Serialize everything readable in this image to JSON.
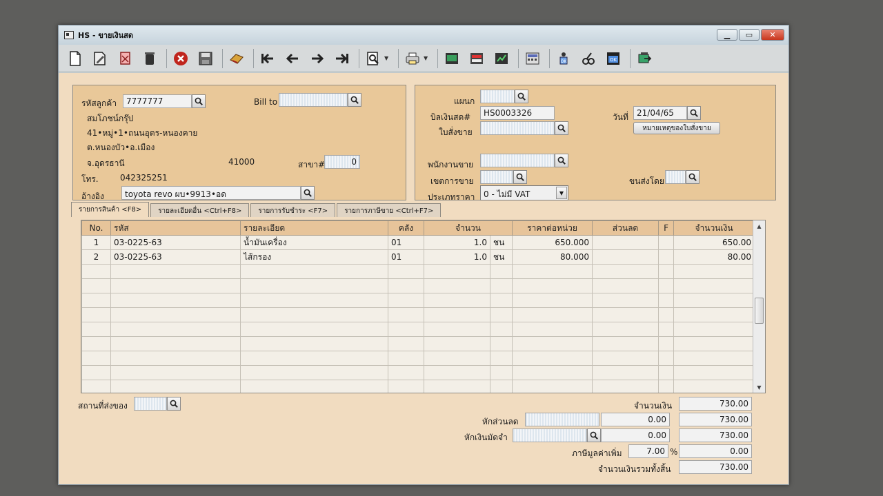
{
  "window": {
    "title": "HS - ขายเงินสด"
  },
  "toolbar": {
    "icons": [
      "new-document-icon",
      "edit-icon",
      "copy-icon",
      "delete-trash-icon",
      "cancel-icon",
      "save-icon",
      "tools-icon",
      "first-record-icon",
      "previous-record-icon",
      "next-record-icon",
      "last-record-icon",
      "search-icon",
      "print-icon",
      "report-icon",
      "excel-export-icon",
      "chart-icon",
      "calculator-icon",
      "approve-icon",
      "link-icon",
      "ok-icon",
      "exit-icon"
    ]
  },
  "customer": {
    "code_label": "รหัสลูกค้า",
    "code_value": "7777777",
    "bill_to_label": "Bill to",
    "name": "สมโภชน์กรุ๊ป",
    "address_line1": "41•หมู่•1•ถนนอุดร-หนองคาย",
    "address_line2": "ต.หนองบัว•อ.เมือง",
    "province": "จ.อุดรธานี",
    "postcode": "41000",
    "branch_label": "สาขา#",
    "branch_value": "0",
    "phone_label": "โทร.",
    "phone_value": "042325251",
    "reference_label": "อ้างอิง",
    "reference_value": "toyota revo ผบ•9913•อด"
  },
  "document": {
    "department_label": "แผนก",
    "bill_no_label": "บิลเงินสด#",
    "bill_no_value": "HS0003326",
    "date_label": "วันที่",
    "date_value": "21/04/65",
    "sales_order_label": "ใบสั่งขาย",
    "sales_order_note_button": "หมายเหตุของใบสั่งขาย",
    "salesperson_label": "พนักงานขาย",
    "sales_area_label": "เขตการขาย",
    "ship_by_label": "ขนส่งโดย",
    "price_type_label": "ประเภทราคา",
    "price_type_value": "0 - ไม่มี VAT"
  },
  "tabs": [
    {
      "label": "รายการสินค้า <F8>",
      "active": true
    },
    {
      "label": "รายละเอียดอื่น <Ctrl+F8>",
      "active": false
    },
    {
      "label": "รายการรับชำระ <F7>",
      "active": false
    },
    {
      "label": "รายการภาษีขาย <Ctrl+F7>",
      "active": false
    }
  ],
  "grid": {
    "headers": {
      "no": "No.",
      "code": "รหัส",
      "desc": "รายละเอียด",
      "wh": "คลัง",
      "qty": "จำนวน",
      "price": "ราคาต่อหน่วย",
      "disc": "ส่วนลด",
      "f": "F",
      "amount": "จำนวนเงิน"
    },
    "rows": [
      {
        "no": "1",
        "code": "03-0225-63",
        "desc": "น้ำมันเครื่อง",
        "wh": "01",
        "qty": "1.0",
        "unit": "ชน",
        "price": "650.000",
        "disc": "",
        "f": "",
        "amount": "650.00"
      },
      {
        "no": "2",
        "code": "03-0225-63",
        "desc": "ไส้กรอง",
        "wh": "01",
        "qty": "1.0",
        "unit": "ชน",
        "price": "80.000",
        "disc": "",
        "f": "",
        "amount": "80.00"
      }
    ]
  },
  "footer": {
    "ship_place_label": "สถานที่ส่งของ",
    "amount_label": "จำนวนเงิน",
    "amount_value": "730.00",
    "discount_label": "หักส่วนลด",
    "discount_value": "0.00",
    "after_discount_value": "730.00",
    "deposit_label": "หักเงินมัดจำ",
    "deposit_value": "0.00",
    "after_deposit_value": "730.00",
    "vat_label": "ภาษีมูลค่าเพิ่ม",
    "vat_rate": "7.00",
    "vat_pct_symbol": "%",
    "vat_value": "0.00",
    "grand_total_label": "จำนวนเงินรวมทั้งสิ้น",
    "grand_total_value": "730.00"
  }
}
